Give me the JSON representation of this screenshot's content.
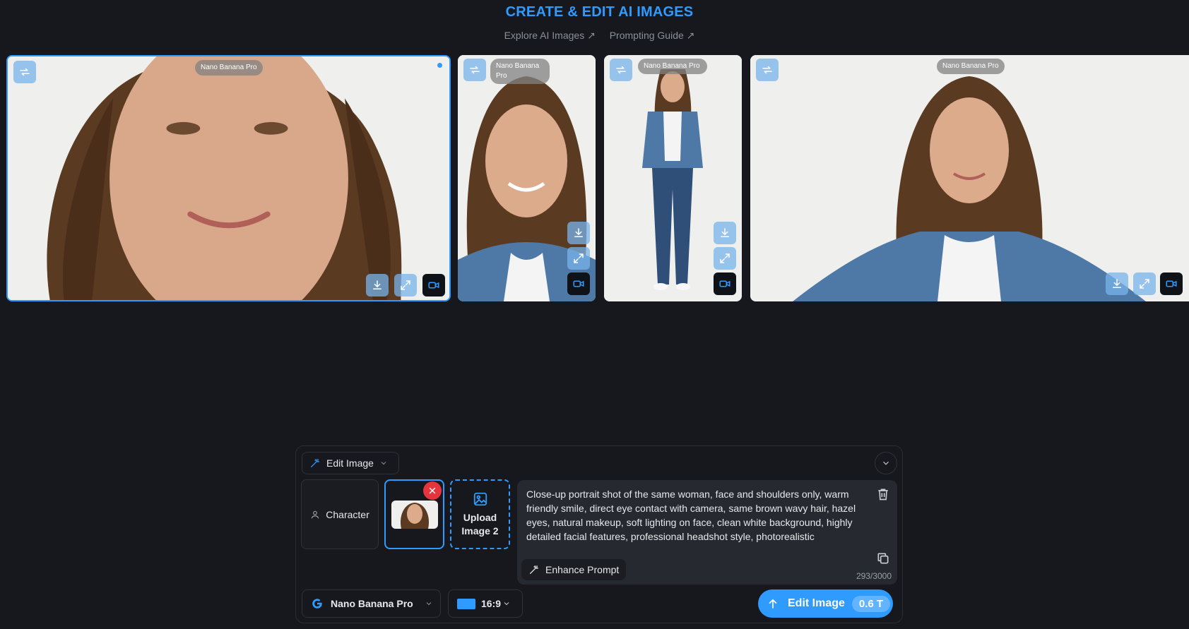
{
  "header": {
    "title": "CREATE & EDIT AI IMAGES",
    "links": [
      "Explore AI Images ↗",
      "Prompting Guide ↗"
    ]
  },
  "gallery": [
    {
      "model": "Nano Banana Pro",
      "selected": true,
      "actions": [
        "repeat-icon",
        "download-icon",
        "expand-icon",
        "video-icon"
      ]
    },
    {
      "model": "Nano Banana Pro",
      "selected": false,
      "actions": [
        "repeat-icon",
        "download-icon",
        "expand-icon",
        "video-icon"
      ]
    },
    {
      "model": "Nano Banana Pro",
      "selected": false,
      "actions": [
        "repeat-icon",
        "download-icon",
        "expand-icon",
        "video-icon"
      ]
    },
    {
      "model": "Nano Banana Pro",
      "selected": false,
      "actions": [
        "repeat-icon",
        "download-icon",
        "expand-icon",
        "video-icon"
      ]
    }
  ],
  "panel": {
    "mode_label": "Edit Image",
    "character_label": "Character",
    "upload_label": "Upload Image 2",
    "prompt": "Close-up portrait shot of the same woman, face and shoulders only, warm friendly smile, direct eye contact with camera, same brown wavy hair, hazel eyes, natural makeup, soft lighting on face, clean white background, highly detailed facial features, professional headshot style, photorealistic",
    "enhance_label": "Enhance Prompt",
    "char_count": "293/3000",
    "model_label": "Nano Banana Pro",
    "aspect_label": "16:9",
    "submit_label": "Edit Image",
    "cost_label": "0.6 T"
  },
  "colors": {
    "accent": "#2f9bff",
    "background": "#16181d",
    "danger": "#e5343c"
  }
}
